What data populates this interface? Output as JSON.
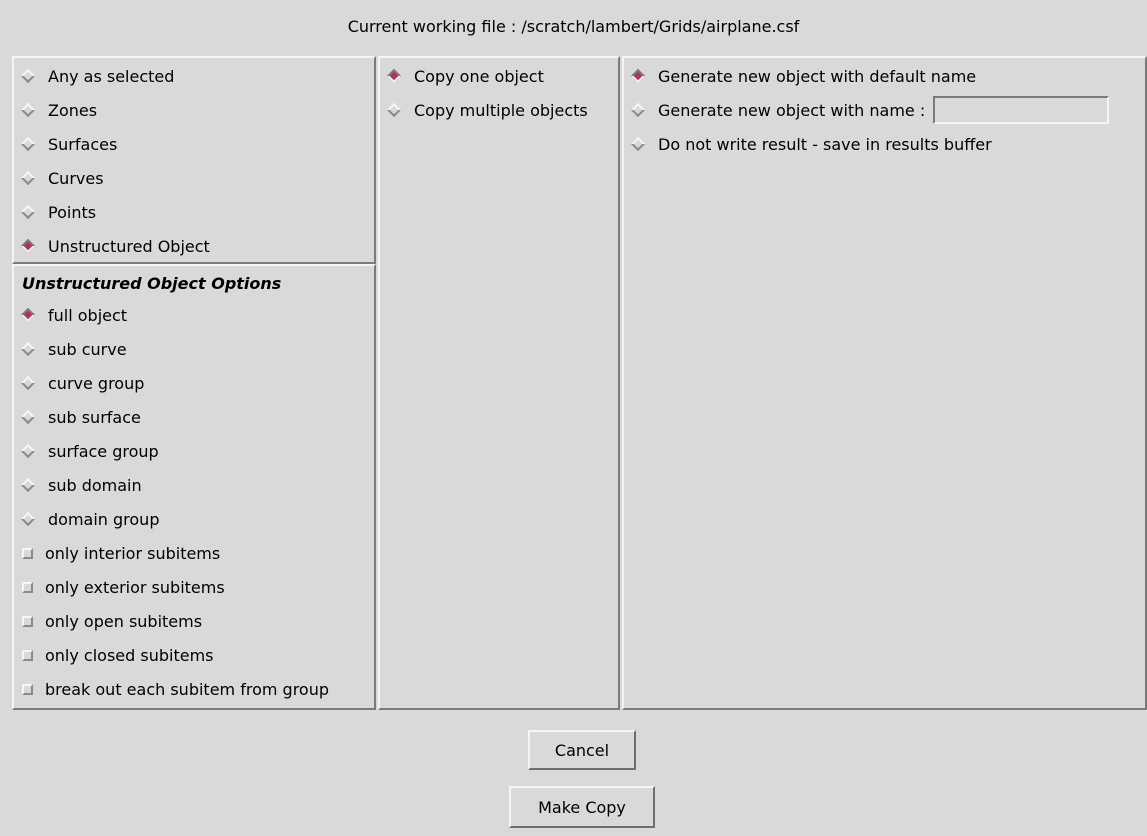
{
  "header": {
    "title": "Current working file : /scratch/lambert/Grids/airplane.csf"
  },
  "object_type": {
    "items": [
      {
        "label": "Any as selected",
        "selected": false
      },
      {
        "label": "Zones",
        "selected": false
      },
      {
        "label": "Surfaces",
        "selected": false
      },
      {
        "label": "Curves",
        "selected": false
      },
      {
        "label": "Points",
        "selected": false
      },
      {
        "label": "Unstructured Object",
        "selected": true
      }
    ]
  },
  "unstructured_options": {
    "title": "Unstructured Object Options",
    "radios": [
      {
        "label": "full object",
        "selected": true
      },
      {
        "label": "sub curve",
        "selected": false
      },
      {
        "label": "curve group",
        "selected": false
      },
      {
        "label": "sub surface",
        "selected": false
      },
      {
        "label": "surface group",
        "selected": false
      },
      {
        "label": "sub domain",
        "selected": false
      },
      {
        "label": "domain group",
        "selected": false
      }
    ],
    "checkboxes": [
      {
        "label": "only interior subitems",
        "checked": false
      },
      {
        "label": "only exterior subitems",
        "checked": false
      },
      {
        "label": "only open subitems",
        "checked": false
      },
      {
        "label": "only closed subitems",
        "checked": false
      },
      {
        "label": "break out each subitem from group",
        "checked": false
      }
    ]
  },
  "copy_mode": {
    "items": [
      {
        "label": "Copy one object",
        "selected": true
      },
      {
        "label": "Copy multiple objects",
        "selected": false
      }
    ]
  },
  "output": {
    "items": [
      {
        "label": "Generate new object with default name",
        "selected": true
      },
      {
        "label": "Generate new object with name :",
        "selected": false
      },
      {
        "label": "Do not write result - save in results buffer",
        "selected": false
      }
    ],
    "name_value": ""
  },
  "buttons": {
    "cancel_label": "Cancel",
    "make_copy_label": "Make Copy"
  },
  "colors": {
    "background": "#d9d9d9",
    "radio_selected": "#b03060"
  }
}
